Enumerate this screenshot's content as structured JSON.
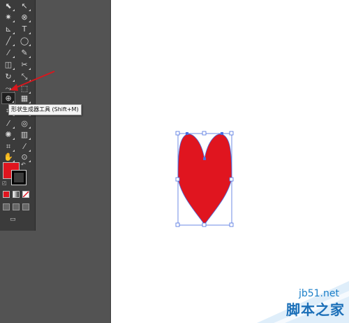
{
  "tools_panel": {
    "rows": [
      {
        "left": "selection-tool",
        "left_icon": "⬉",
        "right": "direct-selection-tool",
        "right_icon": "↖"
      },
      {
        "left": "magic-wand-tool",
        "left_icon": "✷",
        "right": "lasso-tool",
        "right_icon": "⊗"
      },
      {
        "left": "pen-tool",
        "left_icon": "⊾",
        "right": "type-tool",
        "right_icon": "T"
      },
      {
        "left": "line-segment-tool",
        "left_icon": "╱",
        "right": "ellipse-tool",
        "right_icon": "◯"
      },
      {
        "left": "paintbrush-tool",
        "left_icon": "⁄",
        "right": "pencil-tool",
        "right_icon": "✎"
      },
      {
        "left": "blob-brush-tool",
        "left_icon": "◫",
        "right": "scissors-tool",
        "right_icon": "✂"
      },
      {
        "left": "rotate-tool",
        "left_icon": "↻",
        "right": "scale-tool",
        "right_icon": "⤡"
      },
      {
        "left": "width-tool",
        "left_icon": "⤳",
        "right": "free-transform-tool",
        "right_icon": "⬚"
      },
      {
        "left": "shape-builder-tool",
        "left_icon": "⊕",
        "right": "perspective-grid-tool",
        "right_icon": "▦"
      },
      {
        "left": "mesh-tool",
        "left_icon": "⌗",
        "right": "gradient-tool",
        "right_icon": "▣"
      },
      {
        "left": "eyedropper-tool",
        "left_icon": "⁄",
        "right": "blend-tool",
        "right_icon": "◎"
      },
      {
        "left": "symbol-sprayer-tool",
        "left_icon": "✺",
        "right": "column-graph-tool",
        "right_icon": "▥"
      },
      {
        "left": "artboard-tool",
        "left_icon": "⌗",
        "right": "slice-tool",
        "right_icon": "⁄"
      },
      {
        "left": "hand-tool",
        "left_icon": "✋",
        "right": "zoom-tool",
        "right_icon": "⊙"
      }
    ],
    "tooltip": "形状生成器工具 (Shift+M)"
  },
  "colors": {
    "fill": "#e0151f",
    "stroke": "#000000",
    "selection": "#4a6fe0",
    "arrow": "#d8171d",
    "panel": "#3b3b3b",
    "workspace": "#535353"
  },
  "watermark": {
    "site": "jb51.net",
    "name": "脚本之家"
  }
}
